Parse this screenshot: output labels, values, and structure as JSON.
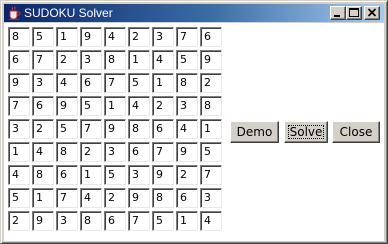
{
  "window": {
    "title": "SUDOKU Solver",
    "icon": "java-coffee-cup-icon",
    "controls": [
      "minimize-icon",
      "maximize-icon",
      "close-icon"
    ]
  },
  "grid": {
    "rows": [
      [
        "8",
        "5",
        "1",
        "9",
        "4",
        "2",
        "3",
        "7",
        "6"
      ],
      [
        "6",
        "7",
        "2",
        "3",
        "8",
        "1",
        "4",
        "5",
        "9"
      ],
      [
        "9",
        "3",
        "4",
        "6",
        "7",
        "5",
        "1",
        "8",
        "2"
      ],
      [
        "7",
        "6",
        "9",
        "5",
        "1",
        "4",
        "2",
        "3",
        "8"
      ],
      [
        "3",
        "2",
        "5",
        "7",
        "9",
        "8",
        "6",
        "4",
        "1"
      ],
      [
        "1",
        "4",
        "8",
        "2",
        "3",
        "6",
        "7",
        "9",
        "5"
      ],
      [
        "4",
        "8",
        "6",
        "1",
        "5",
        "3",
        "9",
        "2",
        "7"
      ],
      [
        "5",
        "1",
        "7",
        "4",
        "2",
        "9",
        "8",
        "6",
        "3"
      ],
      [
        "2",
        "9",
        "3",
        "8",
        "6",
        "7",
        "5",
        "1",
        "4"
      ]
    ]
  },
  "buttons": {
    "demo": "Demo",
    "solve": "Solve",
    "close": "Close"
  },
  "colors": {
    "titlebar_start": "#0a246a",
    "titlebar_end": "#a6caf0",
    "face": "#d4d0c8"
  }
}
